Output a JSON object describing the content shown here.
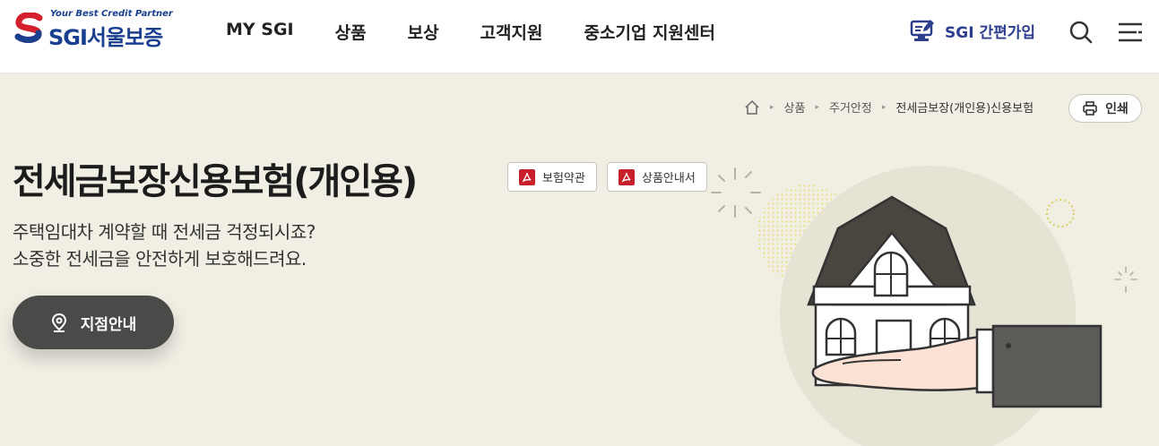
{
  "header": {
    "logo": {
      "tagline": "Your Best Credit Partner",
      "name": "SGI서울보증"
    },
    "nav": [
      {
        "label": "MY SGI"
      },
      {
        "label": "상품"
      },
      {
        "label": "보상"
      },
      {
        "label": "고객지원"
      },
      {
        "label": "중소기업 지원센터"
      }
    ],
    "join_label": "SGI 간편가입",
    "icons": {
      "join": "computer-signup-icon",
      "search": "search-icon",
      "menu": "menu-icon"
    }
  },
  "breadcrumb": {
    "home_icon": "home-icon",
    "items": [
      "상품",
      "주거안정",
      "전세금보장(개인용)신용보험"
    ]
  },
  "print_label": "인쇄",
  "page": {
    "title": "전세금보장신용보험(개인용)",
    "doc_buttons": [
      {
        "label": "보험약관",
        "icon": "pdf-icon"
      },
      {
        "label": "상품안내서",
        "icon": "pdf-icon"
      }
    ],
    "description": [
      "주택임대차 계약할 때 전세금 걱정되시죠?",
      "소중한 전세금을 안전하게 보호해드려요."
    ],
    "branch_button": {
      "label": "지점안내",
      "icon": "location-pin-icon"
    }
  },
  "colors": {
    "brand_blue": "#1b3f8f",
    "brand_red": "#d4202c",
    "background": "#f1efe4",
    "button_dark": "#4a4a48",
    "pdf_red": "#c8202a"
  }
}
